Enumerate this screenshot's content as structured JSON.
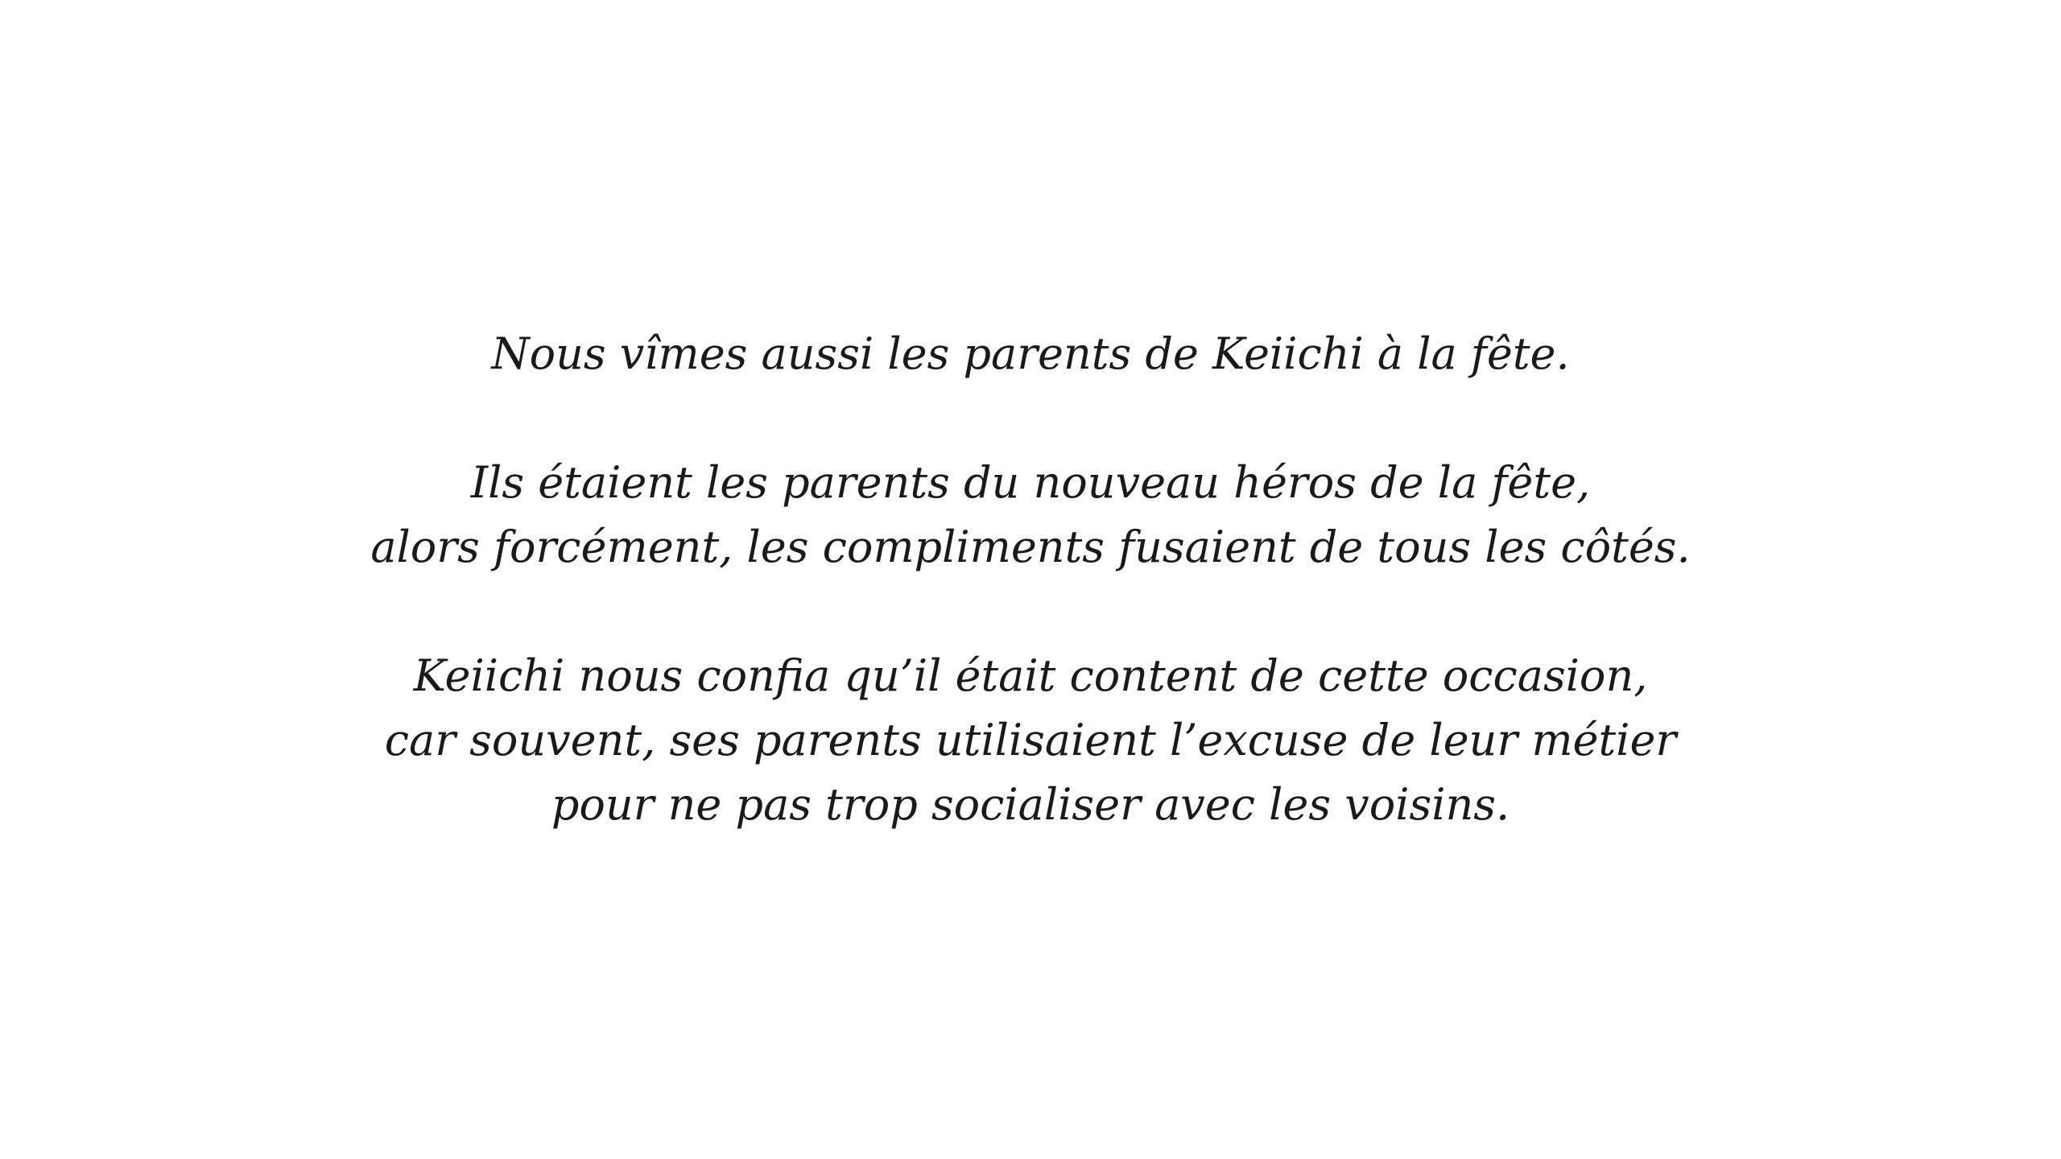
{
  "narration": {
    "paragraphs": [
      {
        "lines": [
          "Nous vîmes aussi les parents de Keiichi à la fête."
        ]
      },
      {
        "lines": [
          "Ils étaient les parents du nouveau héros de la fête,",
          "alors forcément, les compliments fusaient de tous les côtés."
        ]
      },
      {
        "lines": [
          "Keiichi nous confia qu’il était content de cette occasion,",
          "car souvent, ses parents utilisaient l’excuse de leur métier",
          "pour ne pas trop socialiser avec les voisins."
        ]
      }
    ]
  },
  "colors": {
    "background": "#ffffff",
    "text": "#1a1a1a"
  }
}
